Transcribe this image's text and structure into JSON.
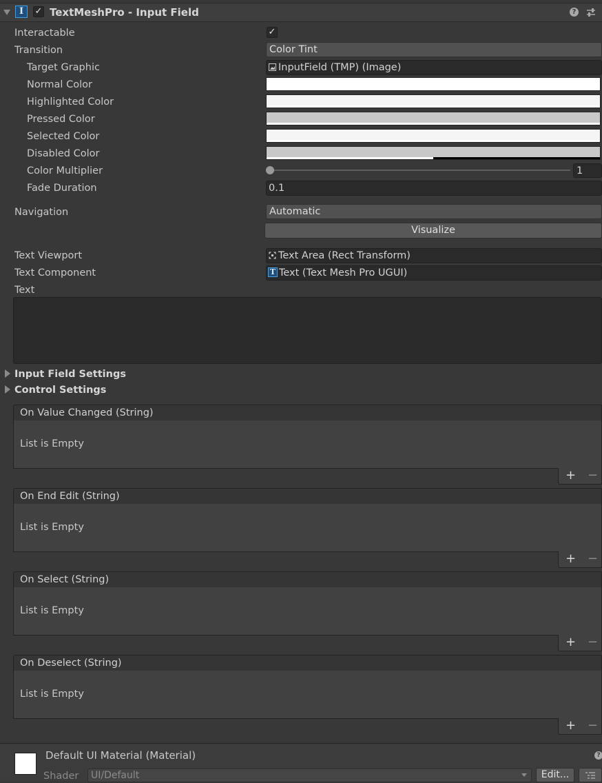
{
  "component": {
    "title": "TextMeshPro - Input Field",
    "enabled_checkmark": "✓"
  },
  "fields": {
    "interactable": {
      "label": "Interactable",
      "check": "✓"
    },
    "transition": {
      "label": "Transition",
      "value": "Color Tint"
    },
    "target_graphic": {
      "label": "Target Graphic",
      "value": "InputField (TMP) (Image)"
    },
    "normal_color": {
      "label": "Normal Color",
      "color": "#ffffff"
    },
    "highlighted_color": {
      "label": "Highlighted Color",
      "color": "#f5f5f5"
    },
    "pressed_color": {
      "label": "Pressed Color",
      "color": "#c8c8c8"
    },
    "selected_color": {
      "label": "Selected Color",
      "color": "#f5f5f5"
    },
    "disabled_color": {
      "label": "Disabled Color",
      "color": "#c8c8c8"
    },
    "color_multiplier": {
      "label": "Color Multiplier",
      "value": "1"
    },
    "fade_duration": {
      "label": "Fade Duration",
      "value": "0.1"
    },
    "navigation": {
      "label": "Navigation",
      "value": "Automatic"
    },
    "visualize": {
      "label": "Visualize"
    },
    "text_viewport": {
      "label": "Text Viewport",
      "value": "Text Area (Rect Transform)"
    },
    "text_component": {
      "label": "Text Component",
      "value": "Text (Text Mesh Pro UGUI)"
    },
    "text": {
      "label": "Text",
      "value": ""
    }
  },
  "foldouts": {
    "input_field_settings": "Input Field Settings",
    "control_settings": "Control Settings"
  },
  "events": [
    {
      "title": "On Value Changed (String)",
      "empty": "List is Empty"
    },
    {
      "title": "On End Edit (String)",
      "empty": "List is Empty"
    },
    {
      "title": "On Select (String)",
      "empty": "List is Empty"
    },
    {
      "title": "On Deselect (String)",
      "empty": "List is Empty"
    }
  ],
  "event_buttons": {
    "add": "+",
    "remove": "−"
  },
  "material": {
    "name": "Default UI Material (Material)",
    "shader_label": "Shader",
    "shader_value": "UI/Default",
    "edit_button": "Edit..."
  },
  "colors": {
    "accent": "#3fa2e6",
    "background": "#383838"
  }
}
